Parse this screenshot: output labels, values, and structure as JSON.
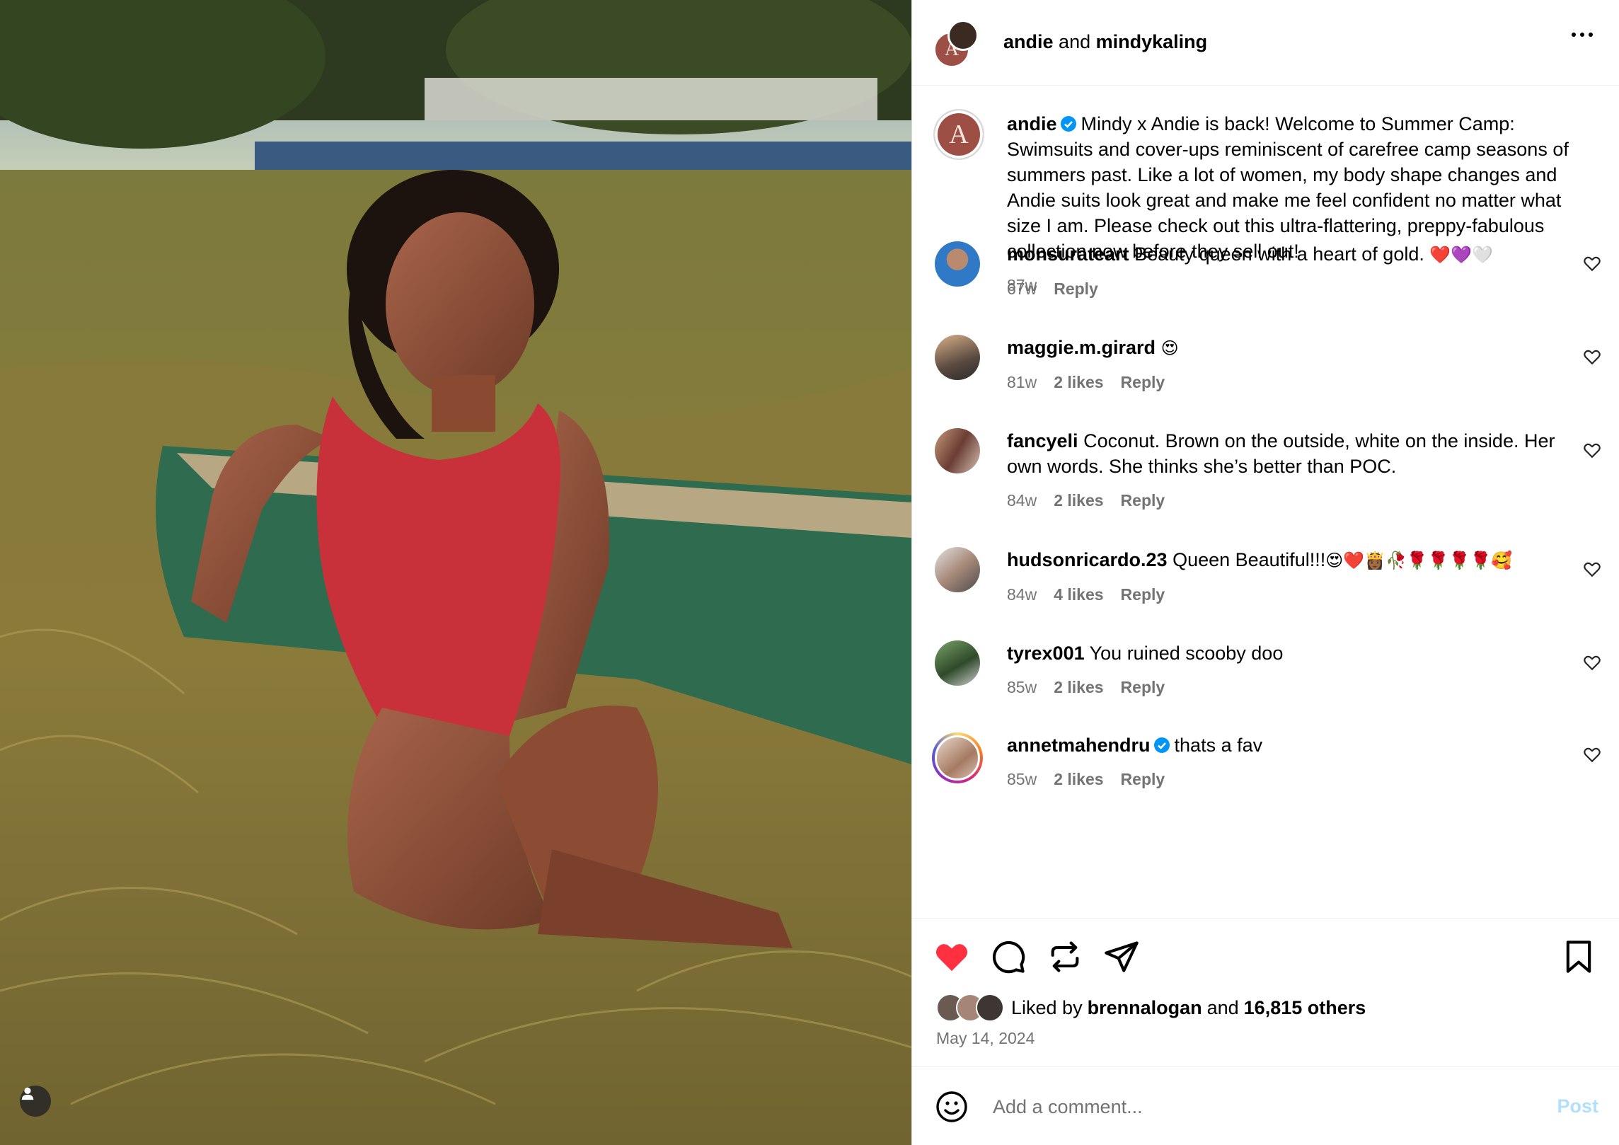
{
  "post": {
    "header": {
      "author": "andie",
      "joiner": "and",
      "collaborator": "mindykaling"
    },
    "caption": {
      "username": "andie",
      "text": "Mindy x Andie is back! Welcome to Summer Camp: Swimsuits and cover-ups reminiscent of carefree camp seasons of summers past. Like a lot of women, my body shape changes and Andie suits look great and make me feel confident no matter what size I am. Please check out this ultra-flattering, preppy-fabulous collection now before they sell out!",
      "time": "87w"
    },
    "comments": [
      {
        "username": "monsurateart",
        "text": "Beauty queen with a heart of gold. ",
        "emoji": "❤️💜🤍",
        "time": "67w",
        "likes": "",
        "reply": "Reply"
      },
      {
        "username": "maggie.m.girard",
        "text": "",
        "emoji": "😍",
        "time": "81w",
        "likes": "2 likes",
        "reply": "Reply"
      },
      {
        "username": "fancyeli",
        "text": "Coconut. Brown on the outside, white on the inside. Her own words. She thinks she’s better than POC.",
        "emoji": "",
        "time": "84w",
        "likes": "2 likes",
        "reply": "Reply"
      },
      {
        "username": "hudsonricardo.23",
        "text": "Queen Beautiful!!!",
        "emoji": "😍❤️👸🏾🥀🌹🌹🌹🌹🥰",
        "time": "84w",
        "likes": "4 likes",
        "reply": "Reply"
      },
      {
        "username": "tyrex001",
        "text": "You ruined scooby doo",
        "emoji": "",
        "time": "85w",
        "likes": "2 likes",
        "reply": "Reply"
      },
      {
        "username": "annetmahendru",
        "text": "thats a fav",
        "emoji": "",
        "time": "85w",
        "likes": "2 likes",
        "reply": "Reply"
      }
    ],
    "likes": {
      "prefix": "Liked by",
      "user": "brennalogan",
      "joiner": "and",
      "others": "16,815 others"
    },
    "date": "May 14, 2024",
    "add_comment": {
      "placeholder": "Add a comment...",
      "post_label": "Post"
    },
    "brand_mark": "A",
    "colors": {
      "like_red": "#ff3040",
      "post_blue": "#b2dffc",
      "verified_blue": "#0095f6",
      "brand": "#9e4f45"
    }
  }
}
